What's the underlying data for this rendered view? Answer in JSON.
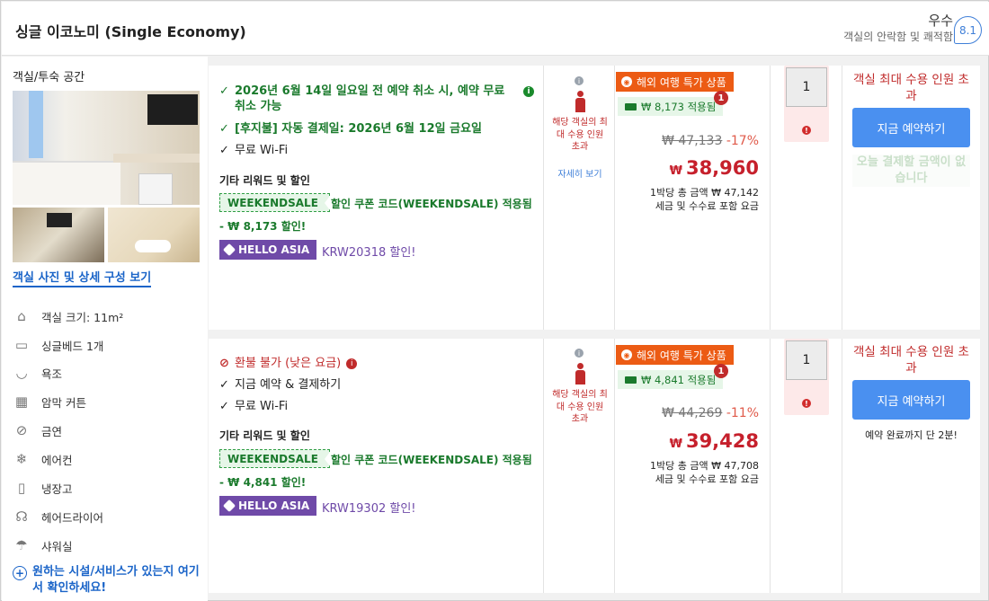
{
  "header": {
    "title": "싱글 이코노미 (Single Economy)",
    "rating_label": "우수",
    "rating_sub": "객실의 안락함 및 쾌적함",
    "score": "8.1"
  },
  "room": {
    "section_title": "객실/투숙 공간",
    "photo_link": "객실 사진 및 상세 구성 보기",
    "amenities": [
      {
        "icon": "room-size-icon",
        "label": "객실 크기: 11m²"
      },
      {
        "icon": "bed-icon",
        "label": "싱글베드 1개"
      },
      {
        "icon": "bathtub-icon",
        "label": "욕조"
      },
      {
        "icon": "blackout-curtain-icon",
        "label": "암막 커튼"
      },
      {
        "icon": "no-smoking-icon",
        "label": "금연"
      },
      {
        "icon": "air-conditioner-icon",
        "label": "에어컨"
      },
      {
        "icon": "refrigerator-icon",
        "label": "냉장고"
      },
      {
        "icon": "hairdryer-icon",
        "label": "헤어드라이어"
      },
      {
        "icon": "shower-icon",
        "label": "샤워실"
      }
    ],
    "more_link": "원하는 시설/서비스가 있는지 여기서 확인하세요!"
  },
  "offers": [
    {
      "cond1": "2026년 6월 14일 일요일 전 예약 취소 시, 예약 무료 취소 가능",
      "cond2": "[후지불] 자동 결제일: 2026년 6월 12일 금요일",
      "cond3": "무료 Wi-Fi",
      "other_title": "기타 리워드 및 할인",
      "coupon_code": "WEEKENDSALE",
      "coupon_text": "할인 쿠폰 코드(WEEKENDSALE) 적용됨",
      "coupon_discount": "- ₩ 8,173 할인!",
      "asia_label": "HELLO ASIA",
      "asia_text": "KRW20318 할인!",
      "occupancy_text": "해당 객실의 최대 수용 인원 초과",
      "occupancy_link": "자세히 보기",
      "promo": "해외 여행 특가 상품",
      "applied": "₩ 8,173 적용됨",
      "badge": "1",
      "orig_price": "₩ 47,133",
      "discount_pct": "-17%",
      "currency": "₩",
      "price": "38,960",
      "total_line1": "1박당 총 금액 ₩ 47,142",
      "total_line2": "세금 및 수수료 포함 요금",
      "qty": "1",
      "max_occ": "객실 최대 수용 인원 초과",
      "book_label": "지금 예약하기",
      "pay_note": "오늘 결제할 금액이 없습니다"
    },
    {
      "cond1": "환불 불가 (낮은 요금)",
      "cond2": "지금 예약 & 결제하기",
      "cond3": "무료 Wi-Fi",
      "other_title": "기타 리워드 및 할인",
      "coupon_code": "WEEKENDSALE",
      "coupon_text": "할인 쿠폰 코드(WEEKENDSALE) 적용됨",
      "coupon_discount": "- ₩ 4,841 할인!",
      "asia_label": "HELLO ASIA",
      "asia_text": "KRW19302 할인!",
      "occupancy_text": "해당 객실의 최대 수용 인원 초과",
      "promo": "해외 여행 특가 상품",
      "applied": "₩ 4,841 적용됨",
      "badge": "1",
      "orig_price": "₩ 44,269",
      "discount_pct": "-11%",
      "currency": "₩",
      "price": "39,428",
      "total_line1": "1박당 총 금액 ₩ 47,708",
      "total_line2": "세금 및 수수료 포함 요금",
      "qty": "1",
      "max_occ": "객실 최대 수용 인원 초과",
      "book_label": "지금 예약하기",
      "finish_note": "예약 완료까지 단 2분!"
    }
  ],
  "colors": {
    "accent": "#4a90f0",
    "price": "#c6202c",
    "green": "#1a7a2c",
    "promo": "#ec5b14",
    "purple": "#6f4aa8"
  }
}
